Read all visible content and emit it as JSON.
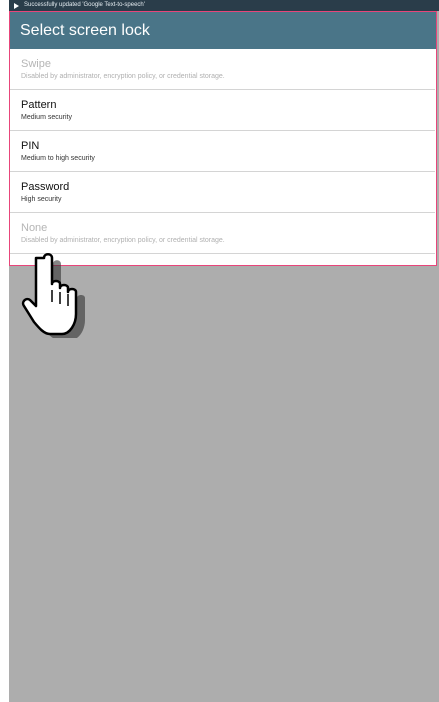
{
  "statusbar": {
    "notification_text": "Successfully updated 'Google Text-to-speech'",
    "icon": "play-store-icon"
  },
  "dialog": {
    "title": "Select screen lock",
    "header_color": "#4a7588",
    "items": [
      {
        "label": "Swipe",
        "sub": "Disabled by administrator, encryption policy, or credential storage.",
        "enabled": false
      },
      {
        "label": "Pattern",
        "sub": "Medium security",
        "enabled": true
      },
      {
        "label": "PIN",
        "sub": "Medium to high security",
        "enabled": true
      },
      {
        "label": "Password",
        "sub": "High security",
        "enabled": true
      },
      {
        "label": "None",
        "sub": "Disabled by administrator, encryption policy, or credential storage.",
        "enabled": false
      }
    ]
  },
  "cursor": {
    "icon": "hand-pointer-icon"
  }
}
